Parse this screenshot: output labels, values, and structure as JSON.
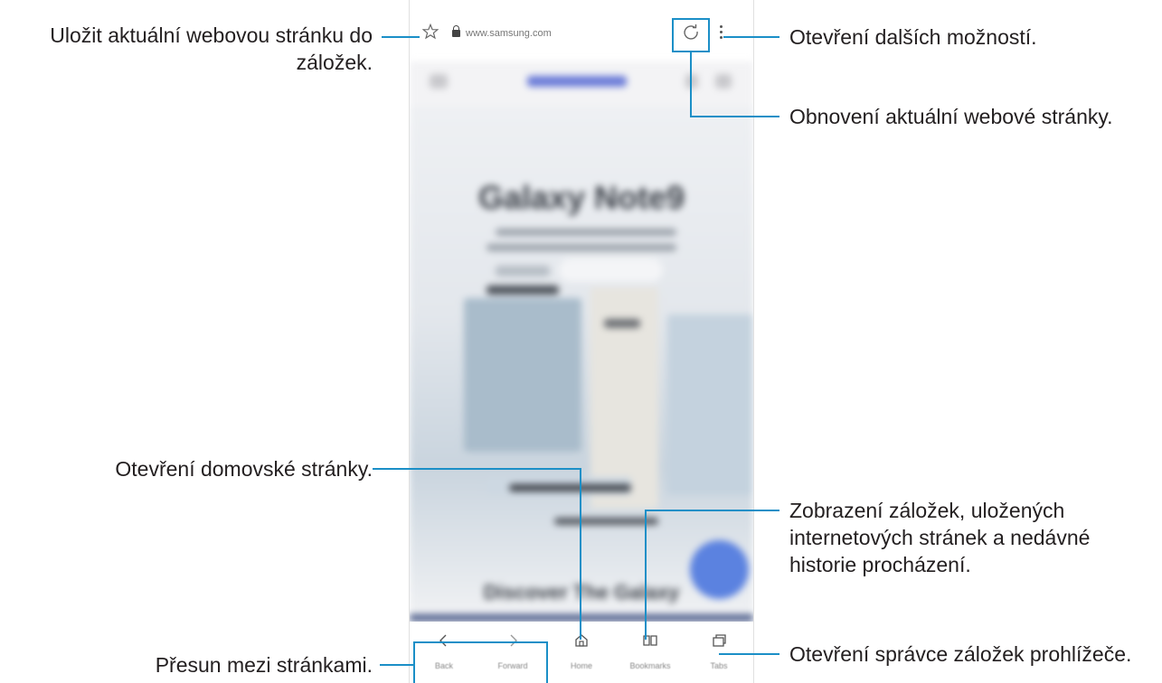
{
  "browser": {
    "url": "www.samsung.com",
    "site_heading": "Galaxy Note9",
    "site_footer_heading": "Discover The Galaxy",
    "nav": [
      {
        "label": "Back",
        "icon": "chevron-left-icon"
      },
      {
        "label": "Forward",
        "icon": "chevron-right-icon"
      },
      {
        "label": "Home",
        "icon": "home-icon"
      },
      {
        "label": "Bookmarks",
        "icon": "book-icon"
      },
      {
        "label": "Tabs",
        "icon": "tabs-icon"
      }
    ]
  },
  "annotations": {
    "bookmark_line1": "Uložit aktuální webovou stránku do",
    "bookmark_line2": "záložek.",
    "more_options": "Otevření dalších možností.",
    "refresh": "Obnovení aktuální webové stránky.",
    "home": "Otevření domovské stránky.",
    "bookmarks_line1": "Zobrazení záložek, uložených",
    "bookmarks_line2": "internetových stránek a nedávné",
    "bookmarks_line3": "historie procházení.",
    "navigate": "Přesun mezi stránkami.",
    "tabs": "Otevření správce záložek prohlížeče."
  },
  "colors": {
    "accent": "#1b8fc7",
    "text": "#231f20"
  }
}
